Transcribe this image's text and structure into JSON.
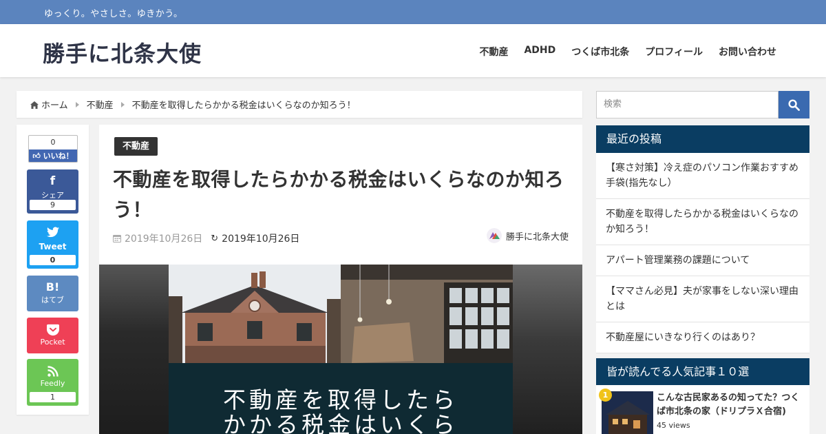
{
  "topbar": {
    "tagline": "ゆっくり。やさしさ。ゆきかう。"
  },
  "header": {
    "site_title": "勝手に北条大使",
    "nav": [
      "不動産",
      "ADHD",
      "つくば市北条",
      "プロフィール",
      "お問い合わせ"
    ]
  },
  "breadcrumb": {
    "items": [
      "ホーム",
      "不動産",
      "不動産を取得したらかかる税金はいくらなのか知ろう！"
    ]
  },
  "share": {
    "like": {
      "count": "0",
      "label": "いいね！"
    },
    "facebook": {
      "icon": "f",
      "label": "シェア",
      "count": "9"
    },
    "twitter": {
      "label": "Tweet",
      "count": "0"
    },
    "hatena": {
      "icon": "B!",
      "label": "はてブ"
    },
    "pocket": {
      "label": "Pocket"
    },
    "feedly": {
      "label": "Feedly",
      "count": "1"
    }
  },
  "article": {
    "category": "不動産",
    "title": "不動産を取得したらかかる税金はいくらなのか知ろう！",
    "published": "2019年10月26日",
    "updated": "2019年10月26日",
    "author": "勝手に北条大使",
    "eyecatch_text_line1": "不動産を取得したら",
    "eyecatch_text_line2": "かかる税金はいくら"
  },
  "sidebar": {
    "search_placeholder": "検索",
    "recent_title": "最近の投稿",
    "recent_posts": [
      "【寒さ対策】冷え症のパソコン作業おすすめ手袋(指先なし）",
      "不動産を取得したらかかる税金はいくらなのか知ろう！",
      "アパート管理業務の課題について",
      "【ママさん必見】夫が家事をしない深い理由とは",
      "不動産屋にいきなり行くのはあり？"
    ],
    "popular_title": "皆が読んでる人気記事１０選",
    "popular": {
      "rank": "1",
      "title": "こんな古民家あるの知ってた？つくば市北条の家（ドリプラＸ合宿)",
      "views": "45 views"
    }
  },
  "colors": {
    "topbar": "#5b84be",
    "widget_title": "#0a3d62",
    "facebook": "#3b5998",
    "twitter": "#1da1f2",
    "hatena": "#5d8ac1",
    "pocket": "#ef4056",
    "feedly": "#6cc655",
    "search_button": "#3a6ab0"
  }
}
